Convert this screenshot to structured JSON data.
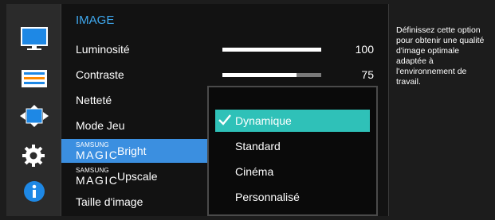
{
  "menu": {
    "title": "IMAGE",
    "items": [
      {
        "label": "Luminosité",
        "value": "100",
        "level": 1.0
      },
      {
        "label": "Contraste",
        "value": "75",
        "level": 0.75
      },
      {
        "label": "Netteté"
      },
      {
        "label": "Mode Jeu"
      },
      {
        "brand": "SAMSUNG",
        "magic": "MAGIC",
        "suffix": "Bright",
        "selected": true
      },
      {
        "brand": "SAMSUNG",
        "magic": "MAGIC",
        "suffix": "Upscale"
      },
      {
        "label": "Taille d'image"
      }
    ]
  },
  "popup": {
    "options": [
      {
        "label": "Dynamique",
        "checked": true,
        "highlighted": true
      },
      {
        "label": "Standard"
      },
      {
        "label": "Cinéma"
      },
      {
        "label": "Personnalisé"
      }
    ]
  },
  "sidebar_icons": [
    "monitor-icon",
    "settings-bars-icon",
    "resize-arrows-icon",
    "gear-icon",
    "info-icon"
  ],
  "help_text": "Définissez cette option pour obtenir une qualité d'image optimale adaptée à l'environnement de travail.",
  "colors": {
    "title": "#3fa8ee",
    "selected_row": "#3b8fe0",
    "highlighted_option": "#2fc1b8"
  }
}
